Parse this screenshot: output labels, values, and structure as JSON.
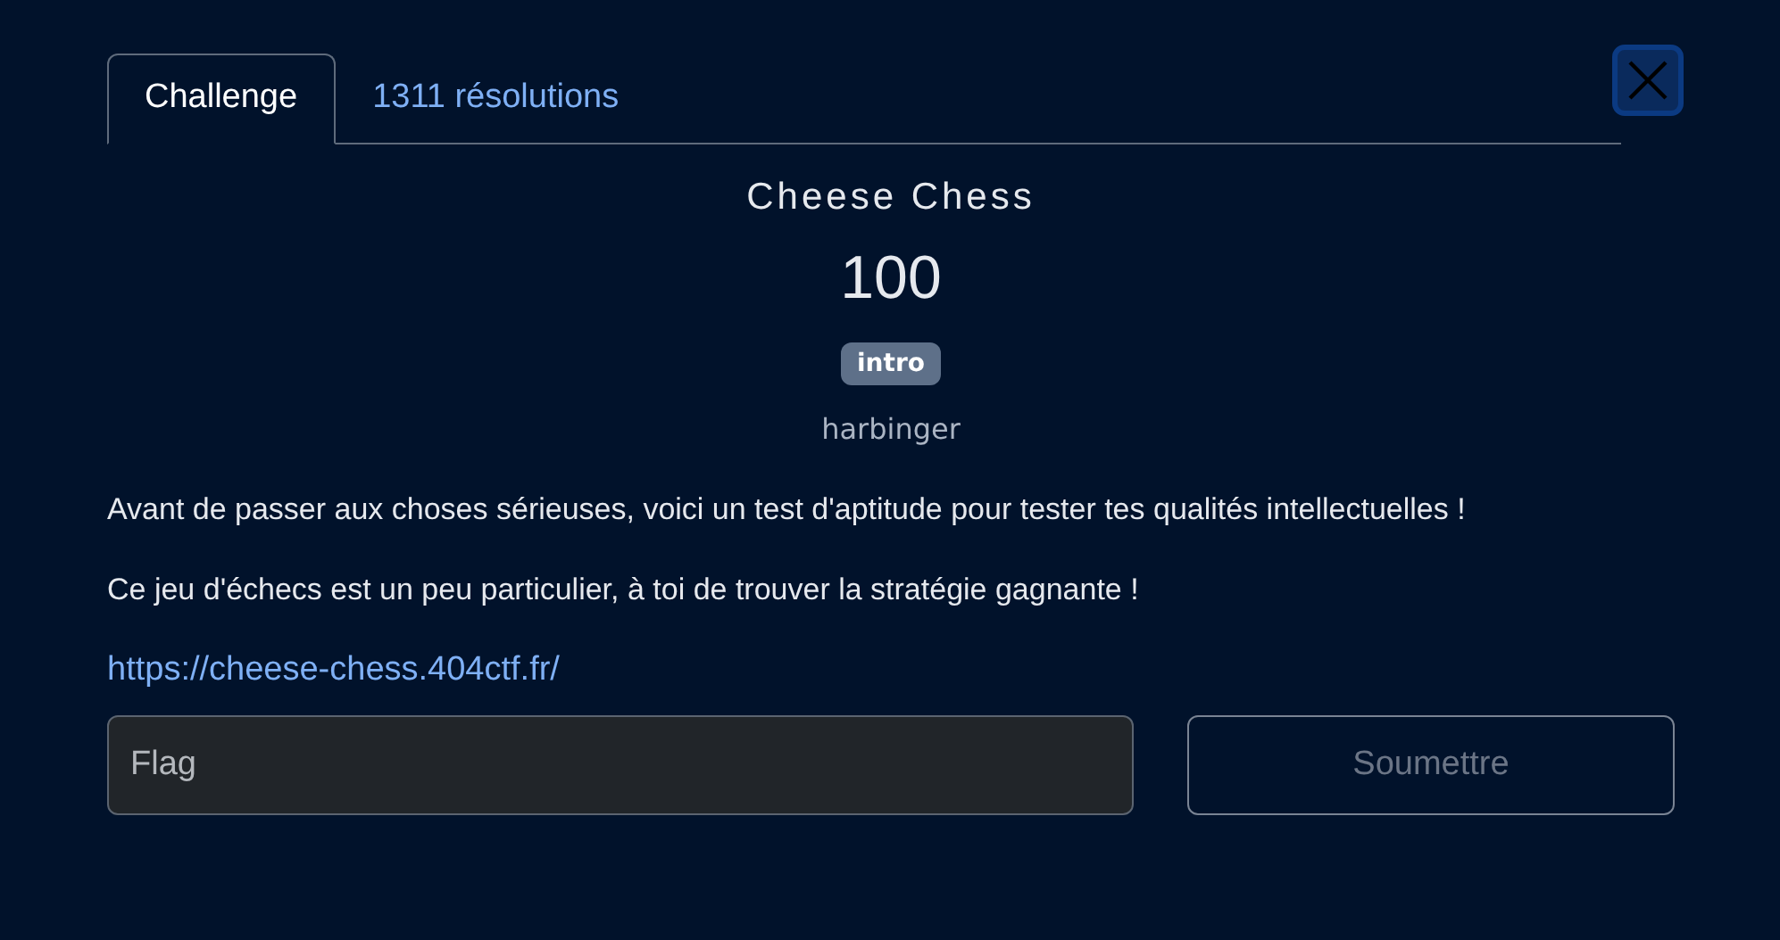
{
  "tabs": [
    {
      "label": "Challenge",
      "selected": true
    },
    {
      "label": "1311 résolutions",
      "selected": false
    }
  ],
  "challenge": {
    "title": "Cheese Chess",
    "points": "100",
    "tag": "intro",
    "author": "harbinger",
    "paragraphs": [
      "Avant de passer aux choses sérieuses, voici un test d'aptitude pour tester tes qualités intellectuelles !",
      "Ce jeu d'échecs est un peu particulier, à toi de trouver la stratégie gagnante !"
    ],
    "link": "https://cheese-chess.404ctf.fr/"
  },
  "flag_field": {
    "placeholder": "Flag"
  },
  "submit_button": {
    "label": "Soumettre",
    "disabled": true
  }
}
